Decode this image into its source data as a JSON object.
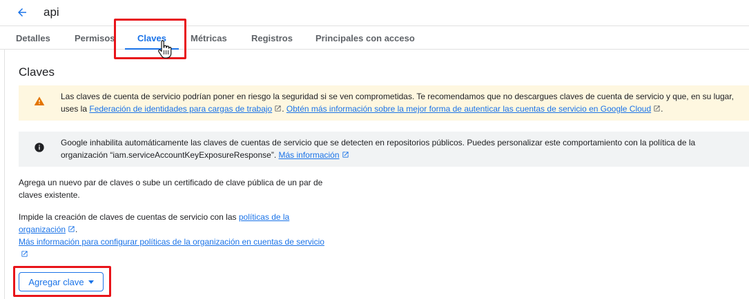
{
  "header": {
    "back_icon": "arrow-left-icon",
    "title": "api"
  },
  "tabs": [
    {
      "label": "Detalles"
    },
    {
      "label": "Permisos"
    },
    {
      "label": "Claves",
      "active": true
    },
    {
      "label": "Métricas"
    },
    {
      "label": "Registros"
    },
    {
      "label": "Principales con acceso"
    }
  ],
  "section_title": "Claves",
  "warning_banner": {
    "icon": "warning-icon",
    "text_before": "Las claves de cuenta de servicio podrían poner en riesgo la seguridad si se ven comprometidas. Te recomendamos que no descargues claves de cuenta de servicio y que, en su lugar, uses la ",
    "link1": "Federación de identidades para cargas de trabajo",
    "text_middle": ". ",
    "link2": "Obtén más información sobre la mejor forma de autenticar las cuentas de servicio en Google Cloud",
    "text_after": "."
  },
  "info_banner": {
    "icon": "info-icon",
    "text_before": "Google inhabilita automáticamente las claves de cuentas de servicio que se detecten en repositorios públicos. Puedes personalizar este comportamiento con la política de la organización “iam.serviceAccountKeyExposureResponse”. ",
    "link": "Más información"
  },
  "intro_text": "Agrega un nuevo par de claves o sube un certificado de clave pública de un par de claves existente.",
  "policy": {
    "text_before": "Impide la creación de claves de cuentas de servicio con las ",
    "link1": "políticas de la organización",
    "text_after": ".",
    "link2": "Más información para configurar políticas de la organización en cuentas de servicio"
  },
  "add_key_button": {
    "label": "Agregar clave",
    "icon": "caret-down-icon"
  },
  "colors": {
    "accent": "#1a73e8",
    "warning_bg": "#fef7e0",
    "warning_icon": "#e37400",
    "info_bg": "#f1f3f4",
    "highlight": "#e8141a"
  }
}
